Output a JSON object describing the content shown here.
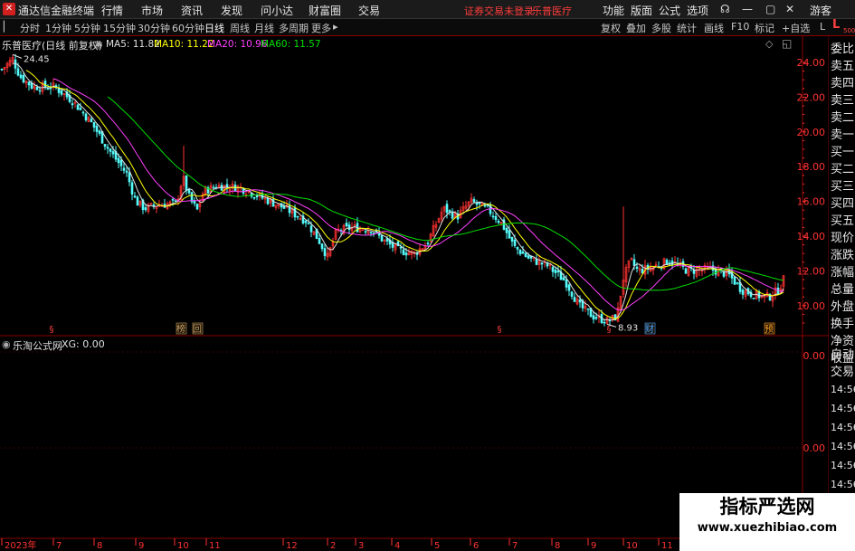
{
  "window": {
    "title": "通达信金融终端",
    "menu": [
      "行情",
      "市场",
      "资讯",
      "发现",
      "问小达",
      "财富圈",
      "交易"
    ],
    "status_red": "证券交易未登录",
    "stock_red": "乐普医疗",
    "right_menu": [
      "功能",
      "版面",
      "公式",
      "选项"
    ],
    "user": "游客"
  },
  "toolbar": {
    "periods": [
      "分时",
      "1分钟",
      "5分钟",
      "15分钟",
      "30分钟",
      "60分钟",
      "日线",
      "周线",
      "月线",
      "多周期",
      "更多"
    ],
    "active_period": "日线",
    "right_tools": [
      "复权",
      "叠加",
      "多股",
      "统计",
      "画线",
      "F10",
      "标记",
      "+自选"
    ]
  },
  "chart": {
    "stock_label": "乐普医疗(日线 前复权)",
    "ma_labels": [
      "MA5: 11.82",
      "MA10: 11.22",
      "MA20: 10.96",
      "MA60: 11.57"
    ],
    "ma_colors": [
      "#e0e0e0",
      "#ffff00",
      "#ff40ff",
      "#00e000"
    ],
    "y_ticks": [
      "24.00",
      "22.00",
      "20.00",
      "18.00",
      "16.00",
      "14.00",
      "12.00",
      "10.00"
    ],
    "high_label": "24.45",
    "low_label": "8.93",
    "event_marks": [
      "榜",
      "回",
      "财",
      "预"
    ],
    "lower_panel": "乐淘公式网",
    "xg_label": "XG: 0.00",
    "lower_ticks": [
      "0.00",
      "0.00",
      "0.00"
    ],
    "x_labels": [
      "2023年",
      "7",
      "8",
      "9",
      "10",
      "11",
      "12",
      "2",
      "3",
      "4",
      "5",
      "6",
      "7",
      "8",
      "9",
      "10",
      "11",
      "12"
    ],
    "lastclose_tag": "L",
    "lastclose_num": "500"
  },
  "sidebar": {
    "items": [
      "委比",
      "卖五",
      "卖四",
      "卖三",
      "卖二",
      "卖一",
      "买一",
      "买二",
      "买三",
      "买四",
      "买五",
      "现价",
      "涨跌",
      "涨幅",
      "总量",
      "外盘",
      "换手",
      "净资",
      "收益"
    ],
    "lower_items": [
      "自动",
      "交易"
    ],
    "times": [
      "14:56",
      "14:56",
      "14:56",
      "14:56",
      "14:56",
      "14:56",
      "14:56",
      "14:56"
    ]
  },
  "watermark": {
    "title": "指标严选网",
    "url": "www.xuezhibiao.com"
  }
}
